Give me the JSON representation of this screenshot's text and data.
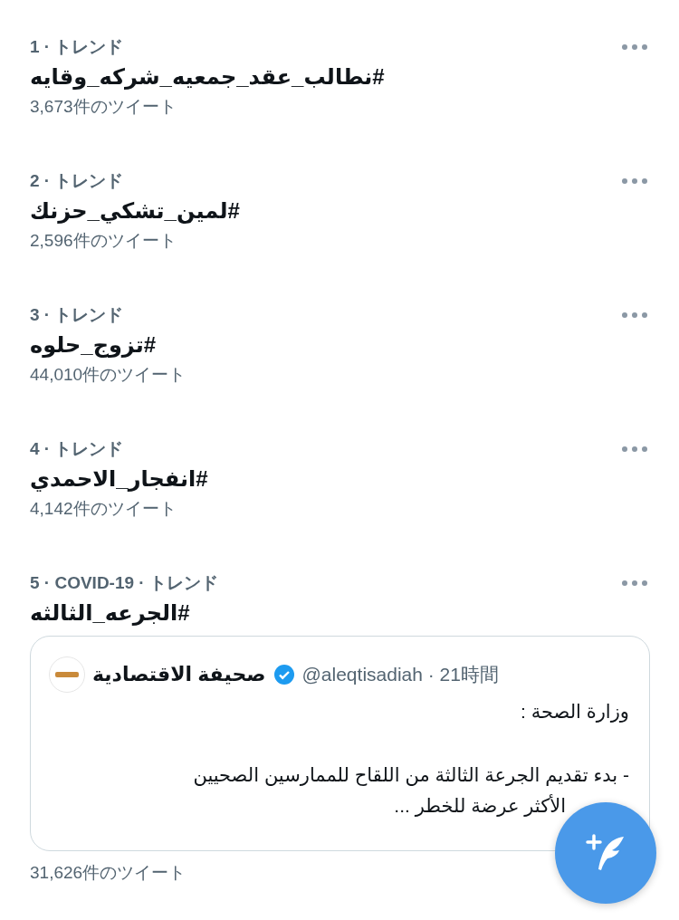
{
  "trends": [
    {
      "meta": "1 · トレンド",
      "hashtag": "#نطالب_عقد_جمعيه_شركه_وقايه",
      "count": "3,673件のツイート"
    },
    {
      "meta": "2 · トレンド",
      "hashtag": "#لمين_تشكي_حزنك",
      "count": "2,596件のツイート"
    },
    {
      "meta": "3 · トレンド",
      "hashtag": "#تزوج_حلوه",
      "count": "44,010件のツイート"
    },
    {
      "meta": "4 · トレンド",
      "hashtag": "#انفجار_الاحمدي",
      "count": "4,142件のツイート"
    },
    {
      "meta": "5 · COVID-19 · トレンド",
      "hashtag": "#الجرعه_الثالثه",
      "tweet": {
        "name": "صحيفة الاقتصادية",
        "verified": true,
        "handle": "@aleqtisadiah · 21時間",
        "title": "وزارة الصحة :",
        "lines": [
          "- بدء تقديم الجرعة الثالثة من اللقاح للممارسين الصحيين",
          "الأكثر عرضة للخطر ..."
        ]
      },
      "count": "31,626件のツイート"
    }
  ]
}
